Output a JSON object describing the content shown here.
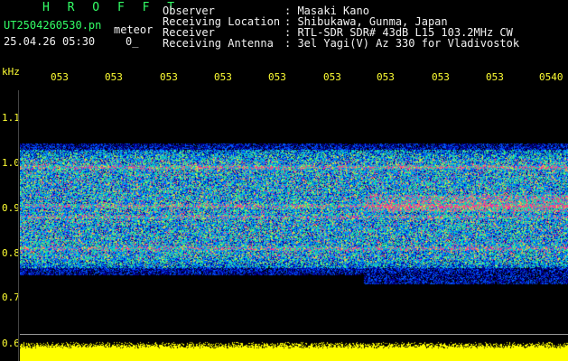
{
  "header": {
    "brand": "H R O F F T",
    "filename": "UT2504260530.pn",
    "meteor_label": "meteor",
    "datetime": "25.04.26 05:30",
    "count": "0_"
  },
  "info": [
    {
      "label": "Observer",
      "value": ": Masaki Kano"
    },
    {
      "label": "Receiving Location",
      "value": ": Shibukawa, Gunma, Japan"
    },
    {
      "label": "Receiver",
      "value": ": RTL-SDR SDR# 43dB L15 103.2MHz CW"
    },
    {
      "label": "Receiving Antenna",
      "value": ": 3el Yagi(V) Az 330 for Vladivostok"
    }
  ],
  "axes": {
    "y_unit": "kHz",
    "y_ticks": [
      "1.1",
      "1.0",
      "0.9",
      "0.8",
      "0.7",
      "0.6"
    ],
    "x_ticks": [
      "053",
      "053",
      "053",
      "053",
      "053",
      "053",
      "053",
      "053",
      "053",
      "0540"
    ]
  },
  "colors": {
    "background": "#000000",
    "brand": "#33ff66",
    "text": "#f2f2f2",
    "ticks": "#ffff33",
    "noise_floor": "#ffff00"
  }
}
